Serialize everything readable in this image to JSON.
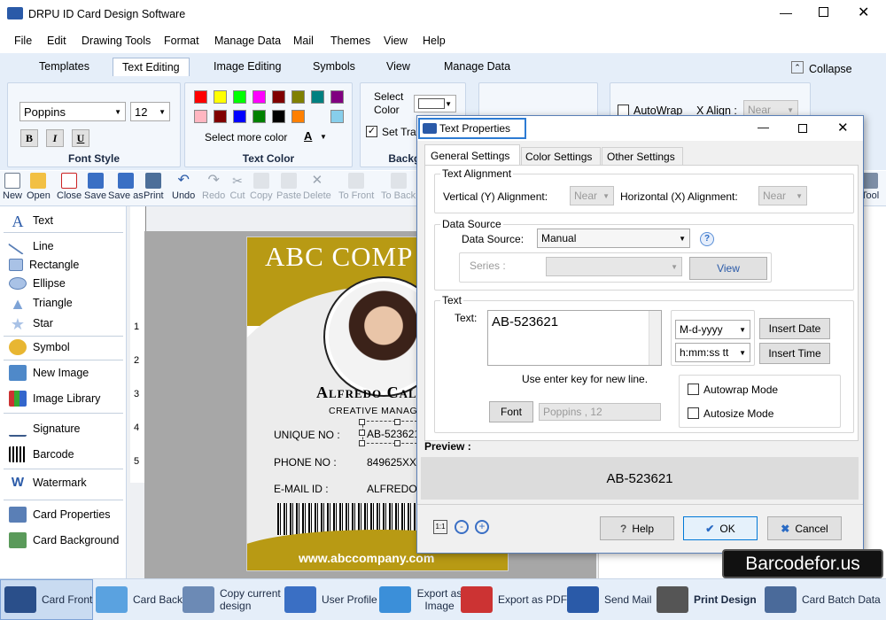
{
  "app": {
    "title": "DRPU ID Card Design Software"
  },
  "menu": [
    "File",
    "Edit",
    "Drawing Tools",
    "Format",
    "Manage Data",
    "Mail",
    "Themes",
    "View",
    "Help"
  ],
  "ribbon_tabs": [
    "Templates",
    "Text Editing",
    "Image Editing",
    "Symbols",
    "View",
    "Manage Data"
  ],
  "ribbon_collapse": "Collapse",
  "font_style": {
    "font": "Poppins",
    "size": "12",
    "bold": "B",
    "italic": "I",
    "underline": "U",
    "label": "Font Style"
  },
  "text_color": {
    "more": "Select more color",
    "a_label": "A",
    "label": "Text Color",
    "colors": [
      "#ff0000",
      "#ffff00",
      "#00ff00",
      "#ff00ff",
      "#800000",
      "#808000",
      "#008080",
      "#800080",
      "#ffb6c1",
      "#800000",
      "#0000ff",
      "#008000",
      "#000000",
      "#ff8000",
      "#87ceeb"
    ]
  },
  "background": {
    "select_color": "Select Color",
    "set_trans": "Set Tran",
    "label": "Backgrou"
  },
  "align_group": {
    "autowrap": "AutoWrap",
    "x_align": "X Align :",
    "x_value": "Near"
  },
  "toolbar": [
    {
      "label": "New"
    },
    {
      "label": "Open"
    },
    {
      "label": "Close"
    },
    {
      "label": "Save"
    },
    {
      "label": "Save as"
    },
    {
      "label": "Print"
    },
    {
      "label": "Undo"
    },
    {
      "label": "Redo"
    },
    {
      "label": "Cut"
    },
    {
      "label": "Copy"
    },
    {
      "label": "Paste"
    },
    {
      "label": "Delete"
    },
    {
      "label": "To Front"
    },
    {
      "label": "To Back"
    }
  ],
  "toolbar_tools": "Tool",
  "left_panel": [
    "Text",
    "Line",
    "Rectangle",
    "Ellipse",
    "Triangle",
    "Star",
    "Symbol",
    "New Image",
    "Image Library",
    "Signature",
    "Barcode",
    "Watermark",
    "Card Properties",
    "Card Background"
  ],
  "ruler_marks": [
    "1",
    "2",
    "3",
    "4",
    "5"
  ],
  "card": {
    "company": "ABC COMP",
    "name": "Alfredo Call",
    "position": "CREATIVE MANAGE",
    "unique_label": "UNIQUE NO :",
    "unique_value": "AB-523621",
    "phone_label": "PHONE NO :",
    "phone_value": "849625XX",
    "email_label": "E-MAIL ID :",
    "email_value": "ALFREDO_",
    "website": "www.abccompany.com"
  },
  "dialog": {
    "title": "Text Properties",
    "tabs": [
      "General Settings",
      "Color Settings",
      "Other Settings"
    ],
    "alignment": {
      "legend": "Text Alignment",
      "vertical_label": "Vertical (Y) Alignment:",
      "vertical_value": "Near",
      "horizontal_label": "Horizontal (X) Alignment:",
      "horizontal_value": "Near"
    },
    "datasource": {
      "legend": "Data Source",
      "label": "Data Source:",
      "value": "Manual",
      "series_label": "Series :",
      "view": "View"
    },
    "text": {
      "legend": "Text",
      "label": "Text:",
      "value": "AB-523621",
      "date_format": "M-d-yyyy",
      "insert_date": "Insert Date",
      "time_format": "h:mm:ss tt",
      "insert_time": "Insert Time",
      "hint": "Use enter key for new line.",
      "font_btn": "Font",
      "font_value": "Poppins , 12",
      "autowrap": "Autowrap Mode",
      "autosize": "Autosize Mode"
    },
    "preview_label": "Preview :",
    "preview_value": "AB-523621",
    "help": "Help",
    "ok": "OK",
    "cancel": "Cancel"
  },
  "watermark": "Barcodefor.us",
  "bottom": [
    "Card Front",
    "Card Back",
    "Copy current design",
    "User Profile",
    "Export as Image",
    "Export as PDF",
    "Send Mail",
    "Print Design",
    "Card Batch Data"
  ]
}
